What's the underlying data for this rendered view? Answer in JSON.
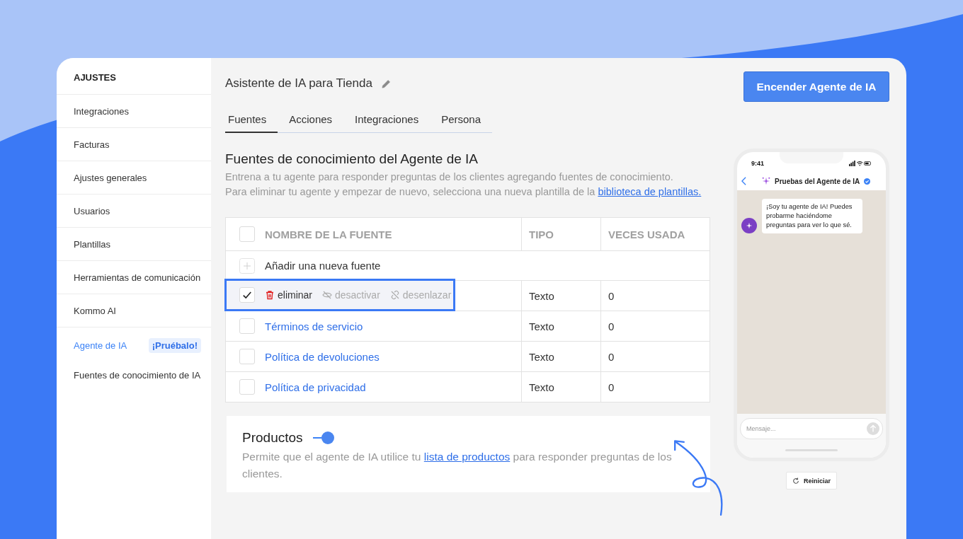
{
  "sidebar": {
    "title": "AJUSTES",
    "items": [
      {
        "label": "Integraciones",
        "selected": false
      },
      {
        "label": "Facturas",
        "selected": false
      },
      {
        "label": "Ajustes generales",
        "selected": false
      },
      {
        "label": "Usuarios",
        "selected": false
      },
      {
        "label": "Plantillas",
        "selected": false
      },
      {
        "label": "Herramientas de comunicación",
        "selected": false
      },
      {
        "label": "Kommo AI",
        "selected": false
      },
      {
        "label": "Agente de IA",
        "selected": true,
        "badge": "¡Pruébalo!",
        "children": [
          {
            "label": "Fuentes de conocimiento de IA",
            "selected": false
          }
        ]
      }
    ]
  },
  "header": {
    "title": "Asistente de IA para Tienda",
    "action_button": "Encender Agente de IA"
  },
  "tabs": [
    {
      "label": "Fuentes",
      "selected": true
    },
    {
      "label": "Acciones",
      "selected": false
    },
    {
      "label": "Integraciones",
      "selected": false
    },
    {
      "label": "Persona",
      "selected": false
    }
  ],
  "section": {
    "heading": "Fuentes de conocimiento del Agente de IA",
    "intro": "Entrena a tu agente para responder preguntas de los clientes agregando fuentes de conocimiento.",
    "description": "Para eliminar tu agente y empezar de nuevo, selecciona una nueva plantilla de la ",
    "link": "biblioteca de plantillas."
  },
  "table": {
    "columns": [
      "NOMBRE DE LA FUENTE",
      "TIPO",
      "VECES USADA"
    ],
    "header_checked": false,
    "add_row": "Añadir una nueva fuente",
    "row_actions": [
      {
        "kind": "delete",
        "label": "eliminar",
        "disabled": false
      },
      {
        "kind": "deactivate",
        "label": "desactivar",
        "disabled": true
      },
      {
        "kind": "unlink",
        "label": "desenlazar",
        "disabled": true
      }
    ],
    "rows": [
      {
        "name": "",
        "type": "Texto",
        "uses": "0",
        "checked": true
      },
      {
        "name": "Términos de servicio",
        "type": "Texto",
        "uses": "0",
        "checked": false
      },
      {
        "name": "Política de devoluciones",
        "type": "Texto",
        "uses": "0",
        "checked": false
      },
      {
        "name": "Política de privacidad",
        "type": "Texto",
        "uses": "0",
        "checked": false
      }
    ]
  },
  "products": {
    "title": "Productos",
    "on": true,
    "text_before": "Permite que el agente de IA utilice tu ",
    "link": "lista de productos",
    "text_after": " para responder preguntas de los clientes."
  },
  "phone": {
    "time": "9:41",
    "chat_title": "Pruebas del Agente de IA",
    "message": "¡Soy tu agente de IA! Puedes probarme haciéndome preguntas para ver lo que sé.",
    "input_placeholder": "Mensaje...",
    "reset_button": "Reiniciar"
  }
}
